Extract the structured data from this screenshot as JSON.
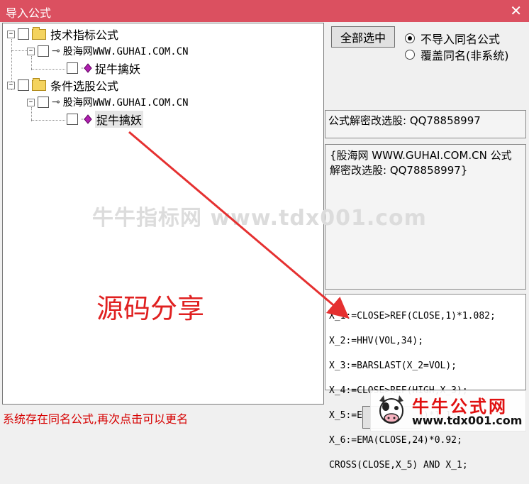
{
  "window": {
    "title": "导入公式",
    "close_glyph": "✕"
  },
  "tree": {
    "expander_collapse": "−",
    "groups": [
      {
        "label": "技术指标公式",
        "author": "股海网WWW.GUHAI.COM.CN",
        "formula": "捉牛擒妖"
      },
      {
        "label": "条件选股公式",
        "author": "股海网WWW.GUHAI.COM.CN",
        "formula": "捉牛擒妖"
      }
    ]
  },
  "options": {
    "select_all_label": "全部选中",
    "radio_no_import": "不导入同名公式",
    "radio_overwrite": "覆盖同名(非系统)",
    "selected": "不导入同名公式"
  },
  "info": {
    "password_line": "公式解密改选股: QQ78858997",
    "description": "{股海网 WWW.GUHAI.COM.CN 公式解密改选股: QQ78858997}"
  },
  "code": {
    "lines": [
      "X_1:=CLOSE>REF(CLOSE,1)*1.082;",
      "X_2:=HHV(VOL,34);",
      "X_3:=BARSLAST(X_2=VOL);",
      "X_4:=CLOSE>REF(HIGH,X_3);",
      "X_5:=EMA(CLOSE,24)*1.15;",
      "X_6:=EMA(CLOSE,24)*0.92;",
      "CROSS(CLOSE,X_5) AND X_1;"
    ]
  },
  "status": {
    "message": "系统存在同名公式,再次点击可以更名"
  },
  "overlay": {
    "watermark": "牛牛指标网 www.tdx001.com",
    "annotation": "源码分享",
    "logo_title": "牛牛公式网",
    "logo_url": "www.tdx001.com"
  },
  "icons": {
    "folder": "folder-icon",
    "key": "key-icon",
    "formula": "diamond-formula-icon",
    "close": "close-icon"
  },
  "colors": {
    "titlebar": "#db5060",
    "status_text": "#d60000",
    "annotation": "#e02020",
    "arrow": "#e53030"
  }
}
